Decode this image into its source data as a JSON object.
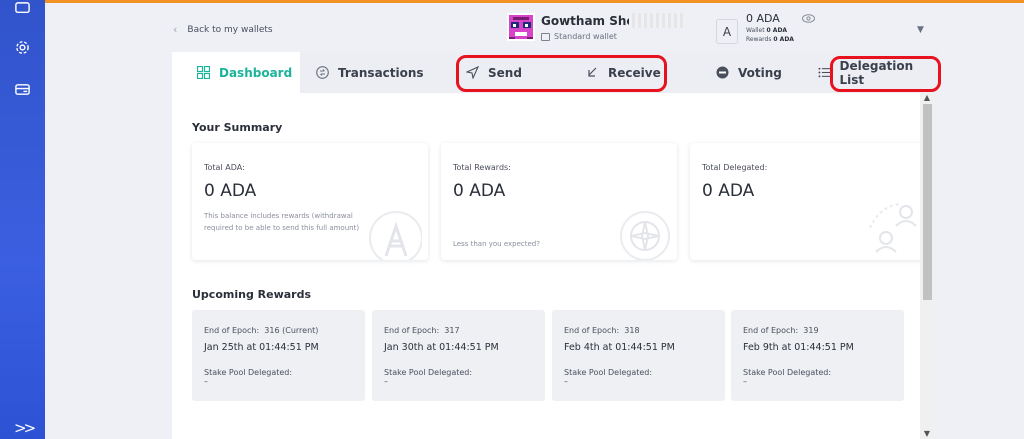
{
  "header": {
    "back_label": "Back to my wallets",
    "wallet_name": "Gowtham Shel..",
    "wallet_type": "Standard wallet",
    "currency_symbol": "A",
    "balance": "0 ADA",
    "wallet_label": "Wallet",
    "wallet_value": "0 ADA",
    "rewards_label": "Rewards",
    "rewards_value": "0 ADA"
  },
  "tabs": [
    {
      "label": "Dashboard",
      "icon": "grid-icon",
      "active": true
    },
    {
      "label": "Transactions",
      "icon": "transactions-icon",
      "active": false
    },
    {
      "label": "Send",
      "icon": "send-icon",
      "active": false
    },
    {
      "label": "Receive",
      "icon": "receive-arrow-icon",
      "active": false
    },
    {
      "label": "Voting",
      "icon": "voting-icon",
      "active": false
    },
    {
      "label": "Delegation List",
      "icon": "list-icon",
      "active": false
    }
  ],
  "summary": {
    "title": "Your Summary",
    "cards": [
      {
        "label": "Total ADA:",
        "value": "0 ADA",
        "note": "This balance includes rewards (withdrawal required to be able to send this full amount)"
      },
      {
        "label": "Total Rewards:",
        "value": "0 ADA",
        "note": "Less than you expected?"
      },
      {
        "label": "Total Delegated:",
        "value": "0 ADA",
        "note": ""
      }
    ]
  },
  "rewards": {
    "title": "Upcoming Rewards",
    "cards": [
      {
        "epoch_label": "End of Epoch:",
        "epoch": "316 (Current)",
        "date": "Jan 25th at 01:44:51 PM",
        "pool_label": "Stake Pool Delegated:",
        "pool_value": "–"
      },
      {
        "epoch_label": "End of Epoch:",
        "epoch": "317",
        "date": "Jan 30th at 01:44:51 PM",
        "pool_label": "Stake Pool Delegated:",
        "pool_value": "–"
      },
      {
        "epoch_label": "End of Epoch:",
        "epoch": "318",
        "date": "Feb 4th at 01:44:51 PM",
        "pool_label": "Stake Pool Delegated:",
        "pool_value": "–"
      },
      {
        "epoch_label": "End of Epoch:",
        "epoch": "319",
        "date": "Feb 9th at 01:44:51 PM",
        "pool_label": "Stake Pool Delegated:",
        "pool_value": "–"
      }
    ]
  },
  "sidebar": {
    "items": [
      {
        "icon": "wallet-icon"
      },
      {
        "icon": "settings-gear-icon"
      },
      {
        "icon": "card-transfer-icon"
      }
    ],
    "expand_icon": "double-chevron-right-icon"
  },
  "colors": {
    "accent": "#1cb39b",
    "sidebar": "#3154cb",
    "topbar": "#f39224",
    "highlight": "#e8111e"
  }
}
